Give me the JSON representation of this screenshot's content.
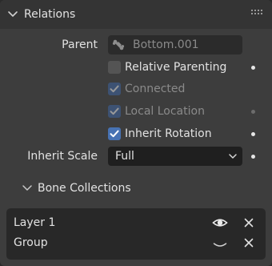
{
  "panel": {
    "title": "Relations",
    "colors": {
      "accent": "#4772b3",
      "panel_bg": "#3d3d3d",
      "header_bg": "#343434"
    }
  },
  "parent": {
    "label": "Parent",
    "placeholder": "Bottom.001",
    "icon": "bone-icon"
  },
  "options": {
    "relative_parenting": {
      "label": "Relative Parenting",
      "checked": false
    },
    "connected": {
      "label": "Connected",
      "checked": true
    },
    "local_location": {
      "label": "Local Location",
      "checked": true
    },
    "inherit_rotation": {
      "label": "Inherit Rotation",
      "checked": true
    }
  },
  "inherit_scale": {
    "label": "Inherit Scale",
    "value": "Full"
  },
  "bone_collections": {
    "title": "Bone Collections",
    "items": [
      {
        "name": "Layer 1",
        "visible": true
      },
      {
        "name": "Group",
        "visible": false
      }
    ]
  }
}
